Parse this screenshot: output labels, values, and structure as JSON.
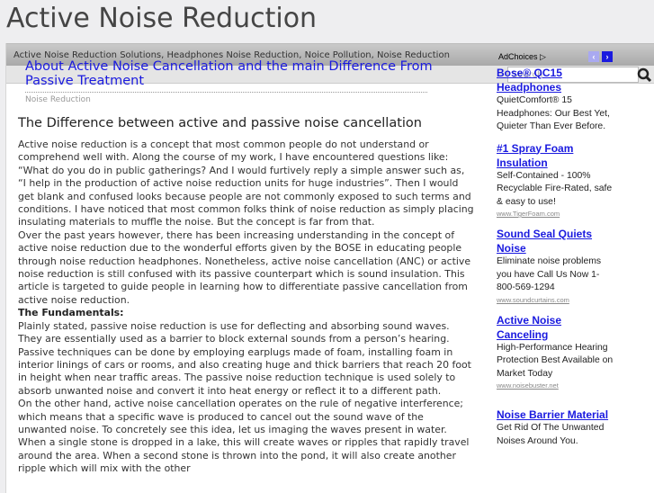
{
  "site": {
    "title": "Active Noise Reduction",
    "tagline": "Active Noise Reduction Solutions, Headphones Noise Reduction, Noice Pollution, Noise Reduction",
    "search_placeholder": "Search"
  },
  "post": {
    "title": "About Active Noise Cancellation and the main Difference From Passive Treatment",
    "category": "Noise Reduction",
    "heading": "The Difference between active and passive noise cancellation",
    "paragraphs": [
      "Active noise reduction is a concept that most common people do not understand or comprehend well with. Along the course of my work, I have encountered questions like: “What do you do in public gatherings? And I would furtively reply a simple answer such as, “I help in the production of active noise reduction units for huge industries”. Then I would get blank and confused looks because people are not commonly exposed to such terms and conditions. I have noticed that most common folks think of noise reduction as simply placing insulating materials to muffle the noise. But the concept is far from that.",
      "Over the past years however, there has been increasing understanding in the concept of active noise reduction due to the wonderful efforts given by the BOSE in educating people through noise reduction headphones. Nonetheless, active noise cancellation (ANC) or active noise reduction is still confused with its passive counterpart which is sound insulation. This article is targeted to guide people in learning how to differentiate passive cancellation from active noise reduction.",
      "The Fundamentals:",
      "Plainly stated, passive noise reduction is use for deflecting and absorbing sound waves. They are essentially used as a barrier to block external sounds from a person’s hearing. Passive techniques can be done by employing earplugs made of foam, installing foam in interior linings of cars or rooms, and also creating huge and thick barriers that reach 20 foot in height when near traffic areas. The passive noise reduction technique is used solely to absorb unwanted noise and convert it into heat energy or reflect it to a different path.",
      "On the other hand, active noise cancellation operates on the rule of negative interference; which means that a specific wave is produced to cancel out the sound wave of the unwanted noise. To concretely see this idea, let us imaging the waves present in water. When a single stone is dropped in a lake, this will create waves or ripples that rapidly travel around the area. When a second stone is thrown into the pond, it will also create another ripple which will mix with the other"
    ]
  },
  "ads": {
    "label": "AdChoices",
    "prev": "‹",
    "next": "›",
    "accent": "#1a1adf",
    "items": [
      {
        "title": "Bose® QC15 Headphones",
        "desc": "QuietComfort® 15 Headphones: Our Best Yet, Quieter Than Ever Before.",
        "url": ""
      },
      {
        "title": "#1 Spray Foam Insulation",
        "desc": "Self-Contained - 100% Recyclable Fire-Rated, safe & easy to use!",
        "url": "www.TigerFoam.com"
      },
      {
        "title": "Sound Seal Quiets Noise",
        "desc": "Eliminate noise problems you have Call Us Now 1-800-569-1294",
        "url": "www.soundcurtains.com"
      },
      {
        "title": "Active Noise Canceling",
        "desc": "High-Performance Hearing Protection Best Available on Market Today",
        "url": "www.noisebuster.net"
      },
      {
        "title": "Noise Barrier Material",
        "desc": "Get Rid Of The Unwanted Noises Around You.",
        "url": ""
      }
    ]
  }
}
